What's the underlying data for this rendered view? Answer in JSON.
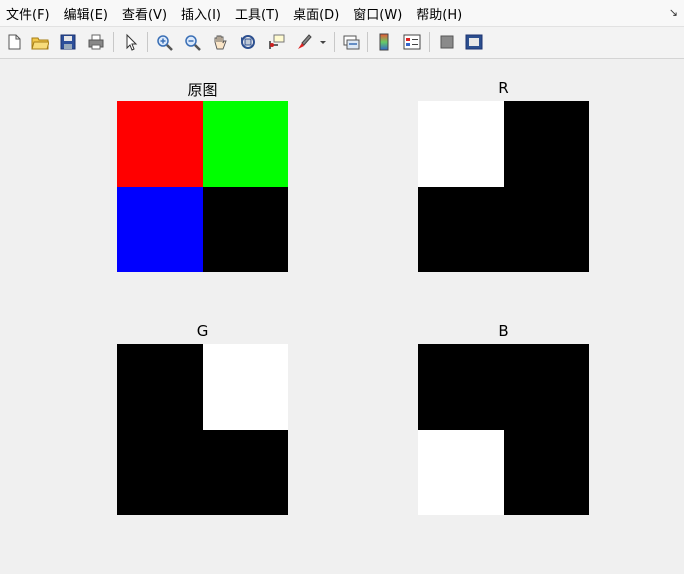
{
  "menu": {
    "items": [
      "文件(F)",
      "编辑(E)",
      "查看(V)",
      "插入(I)",
      "工具(T)",
      "桌面(D)",
      "窗口(W)",
      "帮助(H)"
    ],
    "corner_icon": "dock-arrow-icon"
  },
  "toolbar": {
    "buttons": [
      "new-figure",
      "open-file",
      "save",
      "print",
      "edit-plot-arrow",
      "zoom-in",
      "zoom-out",
      "pan",
      "rotate-3d",
      "data-cursor",
      "brush",
      "link-plot",
      "insert-colorbar",
      "insert-legend",
      "hide-plot-tools",
      "show-plot-tools"
    ]
  },
  "figure": {
    "subplots": [
      {
        "title": "原图",
        "cells": [
          "#ff0000",
          "#00ff00",
          "#0000ff",
          "#000000"
        ]
      },
      {
        "title": "R",
        "cells": [
          "#ffffff",
          "#000000",
          "#000000",
          "#000000"
        ]
      },
      {
        "title": "G",
        "cells": [
          "#000000",
          "#ffffff",
          "#000000",
          "#000000"
        ]
      },
      {
        "title": "B",
        "cells": [
          "#000000",
          "#000000",
          "#ffffff",
          "#000000"
        ]
      }
    ]
  }
}
